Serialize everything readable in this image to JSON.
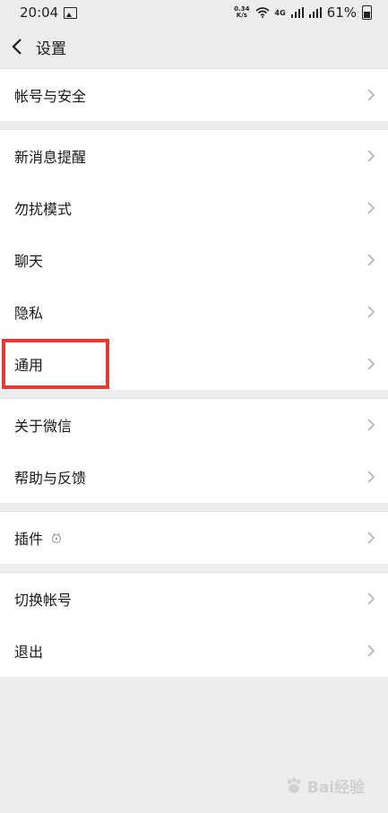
{
  "status_bar": {
    "time": "20:04",
    "net_speed_top": "0.34",
    "net_speed_bottom": "K/s",
    "signal_label": "4G",
    "battery": "61%"
  },
  "nav": {
    "title": "设置"
  },
  "groups": [
    {
      "items": [
        {
          "label": "帐号与安全"
        }
      ]
    },
    {
      "items": [
        {
          "label": "新消息提醒"
        },
        {
          "label": "勿扰模式"
        },
        {
          "label": "聊天"
        },
        {
          "label": "隐私"
        },
        {
          "label": "通用"
        }
      ]
    },
    {
      "items": [
        {
          "label": "关于微信"
        },
        {
          "label": "帮助与反馈"
        }
      ]
    },
    {
      "items": [
        {
          "label": "插件"
        }
      ]
    },
    {
      "items": [
        {
          "label": "切换帐号"
        },
        {
          "label": "退出"
        }
      ]
    }
  ],
  "highlight_target": "通用",
  "watermark": {
    "text": "Bai经验"
  },
  "colors": {
    "highlight": "#e53935",
    "background": "#ededed",
    "chevron": "#b2b2b2"
  }
}
